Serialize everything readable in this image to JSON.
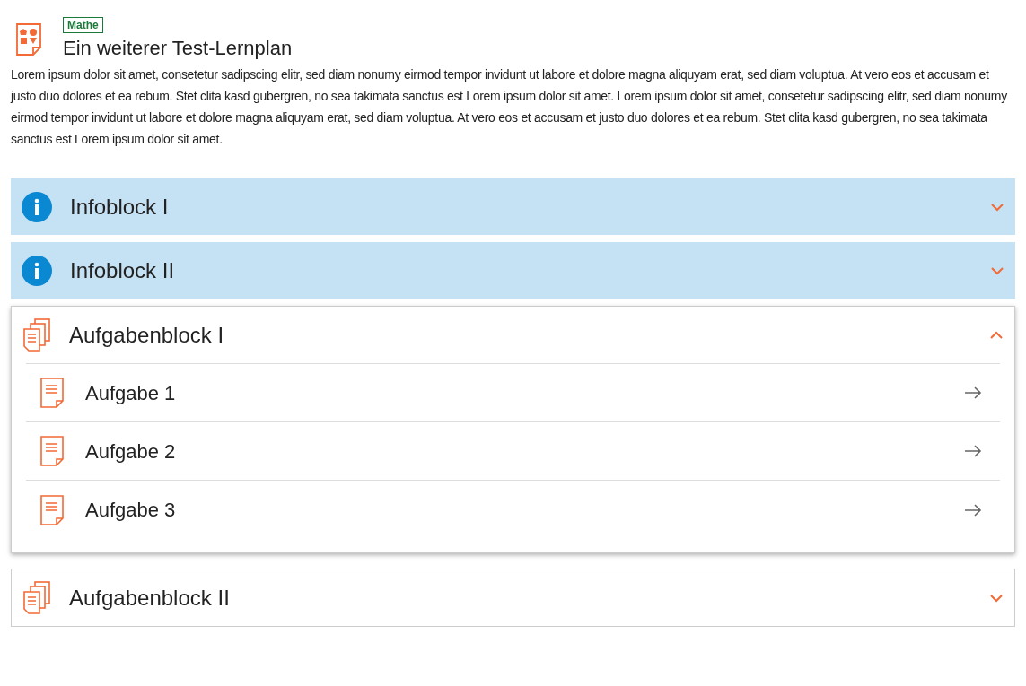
{
  "header": {
    "tag": "Mathe",
    "title": "Ein weiterer Test-Lernplan",
    "description": "Lorem ipsum dolor sit amet, consetetur sadipscing elitr, sed diam nonumy eirmod tempor invidunt ut labore et dolore magna aliquyam erat, sed diam voluptua. At vero eos et accusam et justo duo dolores et ea rebum. Stet clita kasd gubergren, no sea takimata sanctus est Lorem ipsum dolor sit amet. Lorem ipsum dolor sit amet, consetetur sadipscing elitr, sed diam nonumy eirmod tempor invidunt ut labore et dolore magna aliquyam erat, sed diam voluptua. At vero eos et accusam et justo duo dolores et ea rebum. Stet clita kasd gubergren, no sea takimata sanctus est Lorem ipsum dolor sit amet."
  },
  "blocks": [
    {
      "kind": "info",
      "title": "Infoblock I",
      "expanded": false
    },
    {
      "kind": "info",
      "title": "Infoblock II",
      "expanded": false
    },
    {
      "kind": "tasks",
      "title": "Aufgabenblock I",
      "expanded": true,
      "tasks": [
        {
          "title": "Aufgabe 1"
        },
        {
          "title": "Aufgabe 2"
        },
        {
          "title": "Aufgabe 3"
        }
      ]
    },
    {
      "kind": "tasks",
      "title": "Aufgabenblock II",
      "expanded": false
    }
  ]
}
